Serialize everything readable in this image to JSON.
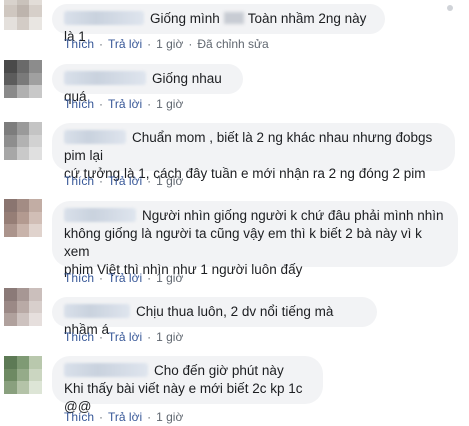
{
  "comments": [
    {
      "text_a": "Giống mình",
      "text_b": "Toàn nhầm 2ng này là 1",
      "like": "Thích",
      "reply": "Trả lời",
      "time": "1 giờ",
      "edited": "Đã chỉnh sửa"
    },
    {
      "text": "Giống nhau quá",
      "like": "Thích",
      "reply": "Trả lời",
      "time": "1 giờ"
    },
    {
      "line1": "Chuẩn mom , biết là 2 ng khác nhau nhưng đobgs pim lại",
      "line2": "cứ tưởng là 1, cách đây tuần e mới nhận ra 2 ng đóng 2 pim",
      "like": "Thích",
      "reply": "Trả lời",
      "time": "1 giờ"
    },
    {
      "line1": "Người nhìn giống người k chứ đâu phải mình nhìn",
      "line2": "không giống là người ta cũng vậy em thì k biết 2 bà này vì k xem",
      "line3": "phim Việt thì nhìn như 1 người luôn đấy",
      "like": "Thích",
      "reply": "Trả lời",
      "time": "1 giờ"
    },
    {
      "text": "Chịu thua luôn, 2 dv nổi tiếng mà nhầm á",
      "like": "Thích",
      "reply": "Trả lời",
      "time": "1 giờ"
    },
    {
      "line1": "Cho đến giờ phút này",
      "line2": "Khi thấy bài viết này e mới biết 2c kp 1c @@",
      "like": "Thích",
      "reply": "Trả lời",
      "time": "1 giờ"
    }
  ],
  "colors": {
    "link": "#385898",
    "bubble": "#f2f3f5",
    "meta": "#606770"
  }
}
